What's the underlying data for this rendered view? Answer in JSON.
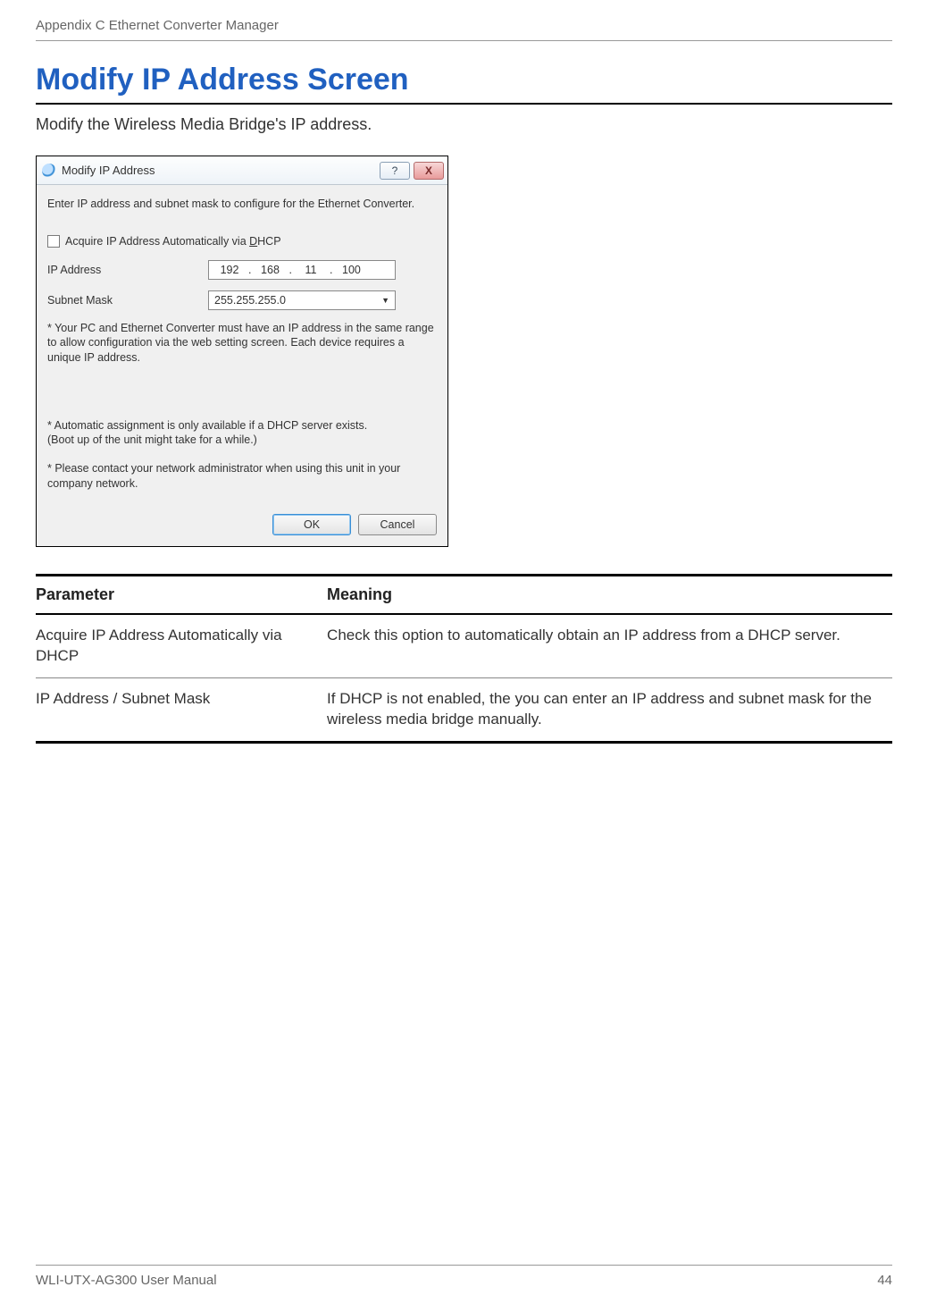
{
  "header": {
    "appendix": "Appendix C  Ethernet Converter Manager"
  },
  "section": {
    "title": "Modify IP Address Screen",
    "desc": "Modify the Wireless Media Bridge's IP address."
  },
  "dialog": {
    "title": "Modify IP Address",
    "help_label": "?",
    "close_label": "X",
    "instruction": "Enter IP address and subnet mask to configure for the Ethernet Converter.",
    "dhcp_checkbox_label": "Acquire IP Address Automatically via DHCP",
    "dhcp_checked": false,
    "ip_label": "IP Address",
    "ip_value": [
      "192",
      "168",
      "11",
      "100"
    ],
    "mask_label": "Subnet Mask",
    "mask_value": "255.255.255.0",
    "note1": "* Your PC and Ethernet Converter must have an IP address in the same range to allow configuration via the web setting screen. Each device requires a unique IP address.",
    "note2": "* Automatic assignment is only available if a DHCP server exists.\n  (Boot up of the unit might take for a while.)",
    "note3": "* Please contact your network administrator when using this unit in your company network.",
    "ok_label": "OK",
    "cancel_label": "Cancel"
  },
  "table": {
    "headers": [
      "Parameter",
      "Meaning"
    ],
    "rows": [
      {
        "param": "Acquire IP Address Automatically via DHCP",
        "meaning": "Check this option to automatically obtain an IP address from a DHCP server."
      },
      {
        "param": "IP Address / Subnet Mask",
        "meaning": "If DHCP is not enabled, the you can enter an IP address and subnet mask for the wireless media bridge manually."
      }
    ]
  },
  "footer": {
    "manual": "WLI-UTX-AG300 User Manual",
    "page": "44"
  }
}
